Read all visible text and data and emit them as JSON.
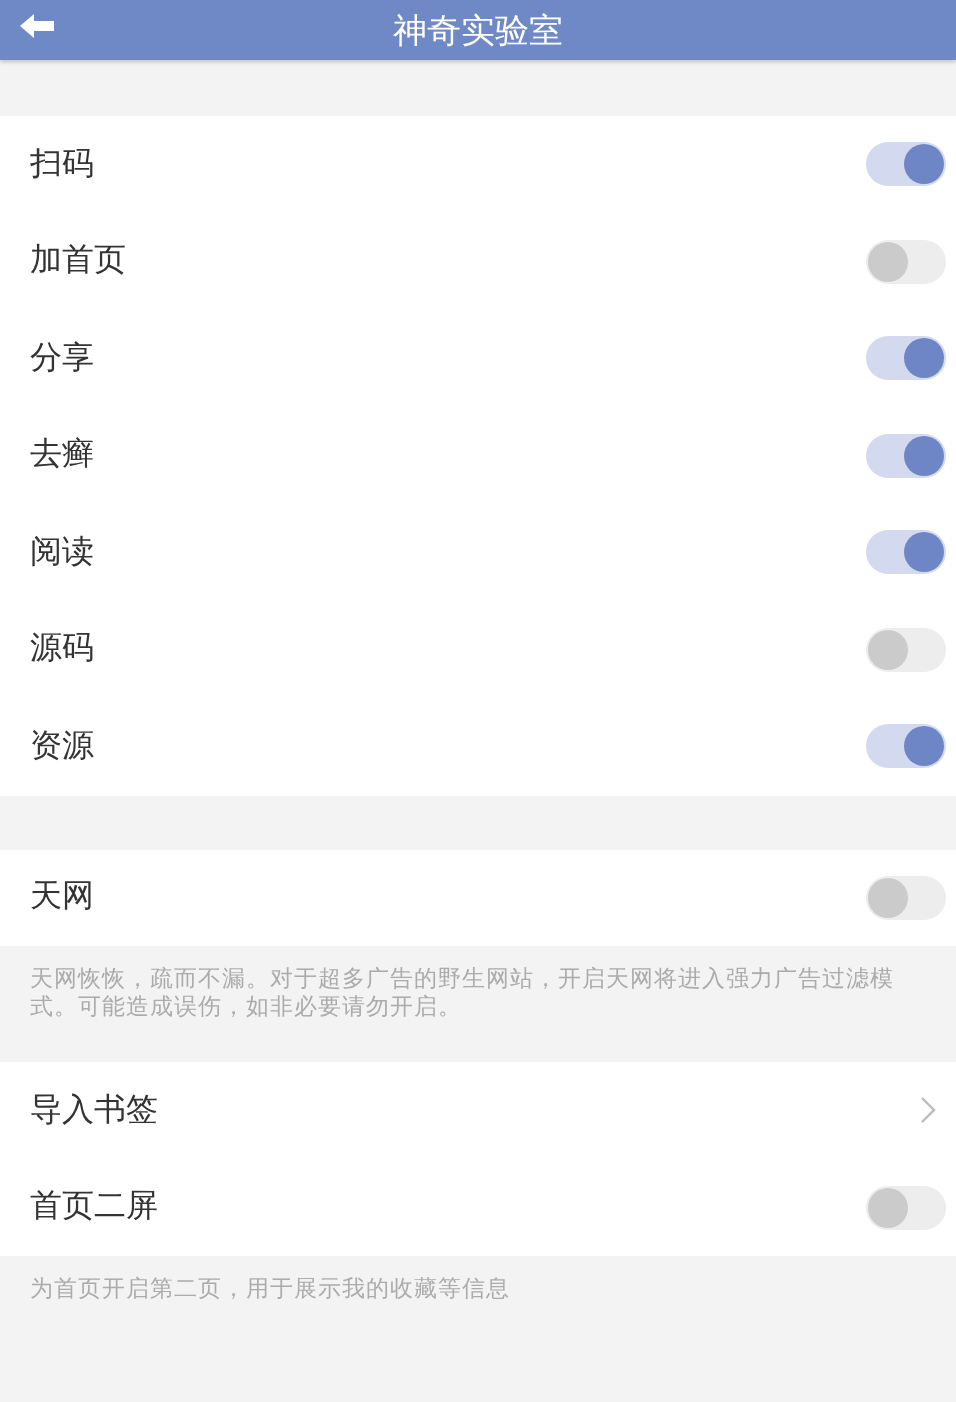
{
  "header": {
    "title": "神奇实验室"
  },
  "sections": [
    {
      "rows": [
        {
          "kind": "toggle",
          "label": "扫码",
          "on": true
        },
        {
          "kind": "toggle",
          "label": "加首页",
          "on": false
        },
        {
          "kind": "toggle",
          "label": "分享",
          "on": true
        },
        {
          "kind": "toggle",
          "label": "去癣",
          "on": true
        },
        {
          "kind": "toggle",
          "label": "阅读",
          "on": true
        },
        {
          "kind": "toggle",
          "label": "源码",
          "on": false
        },
        {
          "kind": "toggle",
          "label": "资源",
          "on": true
        }
      ]
    },
    {
      "rows": [
        {
          "kind": "toggle",
          "label": "天网",
          "on": false
        }
      ],
      "note": "天网恢恢，疏而不漏。对于超多广告的野生网站，开启天网将进入强力广告过滤模式。可能造成误伤，如非必要请勿开启。"
    },
    {
      "rows": [
        {
          "kind": "link",
          "label": "导入书签"
        },
        {
          "kind": "toggle",
          "label": "首页二屏",
          "on": false
        }
      ],
      "note": "为首页开启第二页，用于展示我的收藏等信息"
    }
  ]
}
